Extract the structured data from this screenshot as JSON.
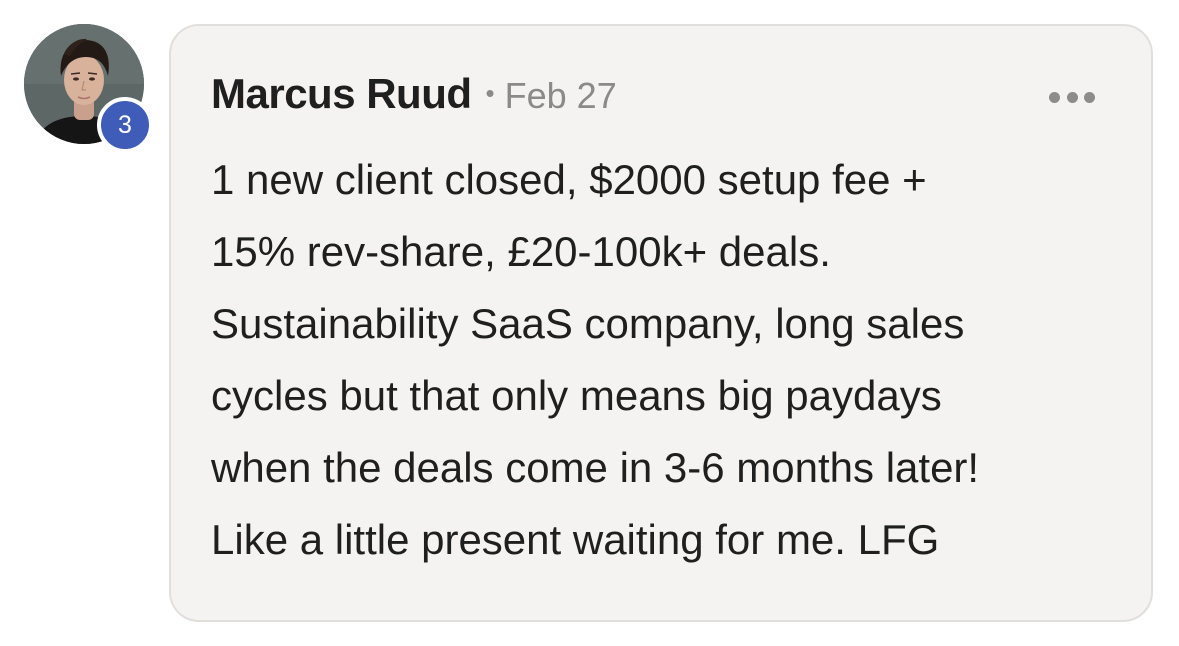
{
  "comment": {
    "author": "Marcus Ruud",
    "separator": "•",
    "date": "Feb 27",
    "level_badge": "3",
    "more_icon": "more-horizontal-icon",
    "body_lines": [
      "1 new client closed, $2000 setup fee +",
      "15% rev-share, £20-100k+ deals.",
      "Sustainability SaaS company, long sales",
      "cycles but that only means big paydays",
      "when the deals come in 3-6 months later!",
      "Like a little present waiting for me. LFG"
    ]
  },
  "colors": {
    "bubble_background": "#f4f3f1",
    "bubble_border": "#e0dfdc",
    "badge": "#3f5cb8",
    "text": "#1f1f1f",
    "muted": "#8a8a8a"
  }
}
